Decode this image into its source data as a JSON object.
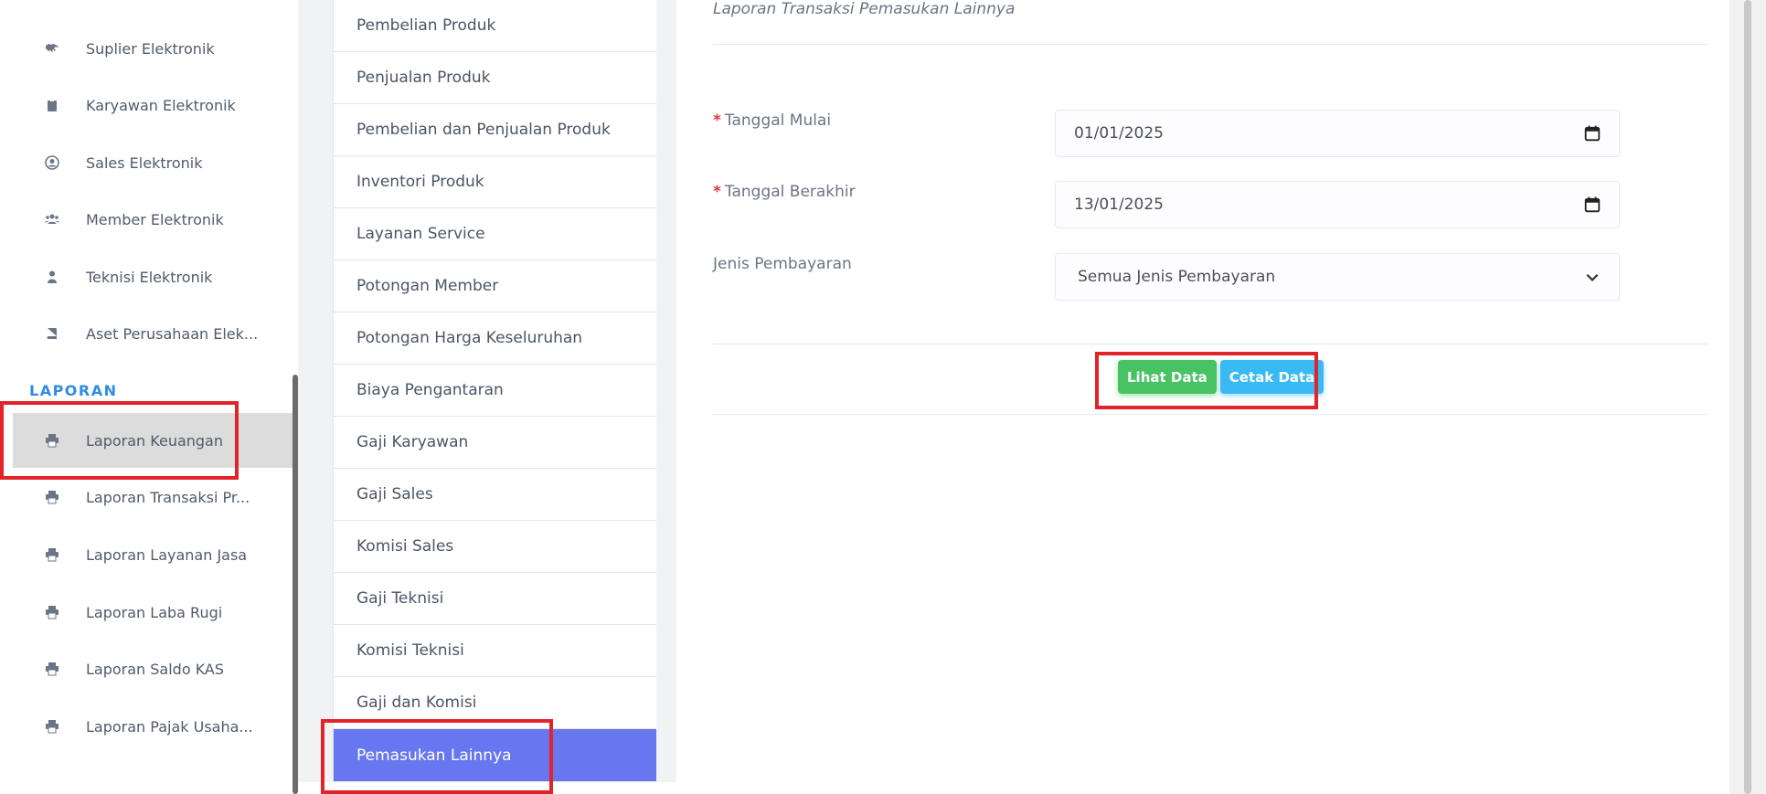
{
  "sidebar": {
    "items": [
      {
        "label": "Suplier Elektronik",
        "icon": "handshake-icon"
      },
      {
        "label": "Karyawan Elektronik",
        "icon": "id-badge-icon"
      },
      {
        "label": "Sales Elektronik",
        "icon": "user-circle-icon"
      },
      {
        "label": "Member Elektronik",
        "icon": "users-icon"
      },
      {
        "label": "Teknisi Elektronik",
        "icon": "user-icon"
      },
      {
        "label": "Aset Perusahaan Elek...",
        "icon": "book-icon"
      }
    ],
    "section_label": "LAPORAN",
    "report_items": [
      {
        "label": "Laporan Keuangan",
        "icon": "print-icon",
        "active": true
      },
      {
        "label": "Laporan Transaksi Pr...",
        "icon": "print-icon"
      },
      {
        "label": "Laporan Layanan Jasa",
        "icon": "print-icon"
      },
      {
        "label": "Laporan Laba Rugi",
        "icon": "print-icon"
      },
      {
        "label": "Laporan Saldo KAS",
        "icon": "print-icon"
      },
      {
        "label": "Laporan Pajak Usaha...",
        "icon": "print-icon"
      }
    ]
  },
  "submenu": {
    "items": [
      "Pembelian Produk",
      "Penjualan Produk",
      "Pembelian dan Penjualan Produk",
      "Inventori Produk",
      "Layanan Service",
      "Potongan Member",
      "Potongan Harga Keseluruhan",
      "Biaya Pengantaran",
      "Gaji Karyawan",
      "Gaji Sales",
      "Komisi Sales",
      "Gaji Teknisi",
      "Komisi Teknisi",
      "Gaji dan Komisi",
      "Pemasukan Lainnya"
    ],
    "active_item": "Pemasukan Lainnya"
  },
  "panel": {
    "title": "Laporan Transaksi Pemasukan Lainnya",
    "required_mark": "*",
    "start_date_label": "Tanggal Mulai",
    "start_date_value": "01/01/2025",
    "end_date_label": "Tanggal Berakhir",
    "end_date_value": "13/01/2025",
    "payment_label": "Jenis Pembayaran",
    "payment_value": "Semua Jenis Pembayaran",
    "view_button": "Lihat Data",
    "print_button": "Cetak Data"
  },
  "colors": {
    "accent": "#6777ef",
    "section": "#2f8ee0",
    "success": "#47c363",
    "info": "#3abaf4",
    "highlight": "#e0242a"
  }
}
